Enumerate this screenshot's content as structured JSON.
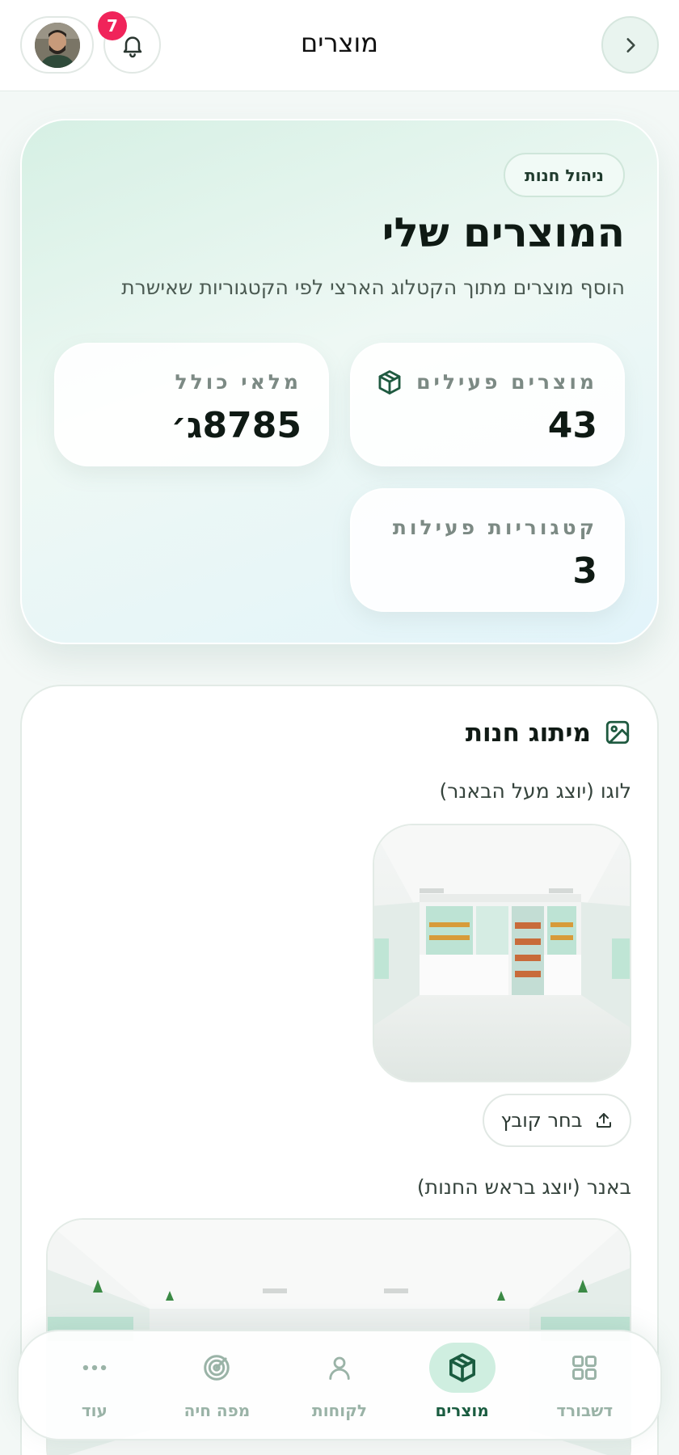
{
  "header": {
    "title": "מוצרים",
    "notification_count": "7"
  },
  "hero": {
    "pill": "ניהול חנות",
    "title": "המוצרים שלי",
    "subtitle": "הוסף מוצרים מתוך הקטלוג הארצי לפי הקטגוריות שאישרת",
    "stats": [
      {
        "label": "מוצרים פעילים",
        "value": "43",
        "icon": "package-icon"
      },
      {
        "label": "מלאי כולל",
        "value": "8785ג׳"
      },
      {
        "label": "קטגוריות פעילות",
        "value": "3"
      }
    ]
  },
  "branding": {
    "title": "מיתוג חנות",
    "logo_label": "לוגו (יוצג מעל הבאנר)",
    "choose_file": "בחר קובץ",
    "banner_label": "באנר (יוצג בראש החנות)"
  },
  "nav": {
    "items": [
      {
        "label": "דשבורד",
        "icon": "dashboard-icon",
        "active": false
      },
      {
        "label": "מוצרים",
        "icon": "package-icon",
        "active": true
      },
      {
        "label": "לקוחות",
        "icon": "user-icon",
        "active": false
      },
      {
        "label": "מפה חיה",
        "icon": "radar-icon",
        "active": false
      },
      {
        "label": "עוד",
        "icon": "more-icon",
        "active": false
      }
    ]
  },
  "colors": {
    "accent": "#1a5c40",
    "badge": "#f0245a",
    "nav_active_bg": "#cfeee0"
  }
}
